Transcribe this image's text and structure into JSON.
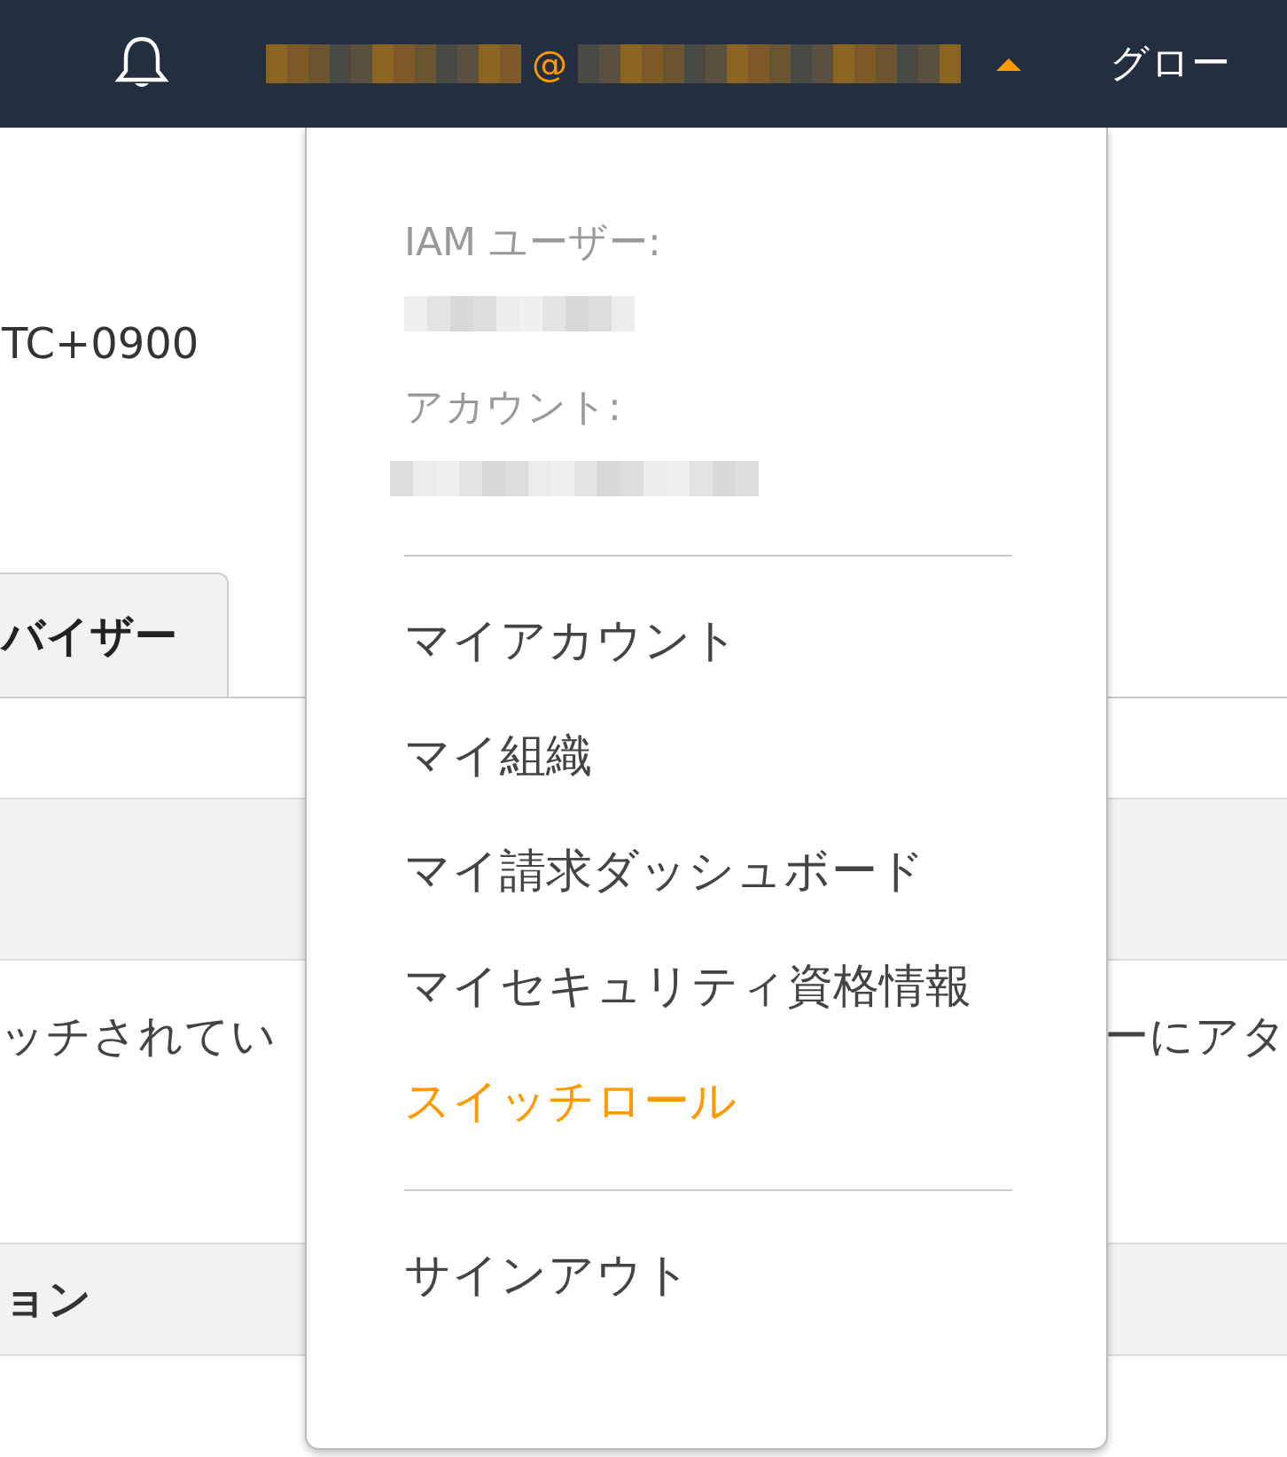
{
  "top_bar": {
    "at_sign": "@",
    "region_label": "グロー"
  },
  "page": {
    "timezone": "TC+0900",
    "tab": {
      "label": "バイザー",
      "selected": true
    },
    "text_left": "ッチされてい",
    "text_right": "ーにアタ",
    "section_header": "ョン"
  },
  "account_menu": {
    "iam_user_label": "IAM ユーザー:",
    "account_label": "アカウント:",
    "items": [
      {
        "label": "マイアカウント",
        "accent": false
      },
      {
        "label": "マイ組織",
        "accent": false
      },
      {
        "label": "マイ請求ダッシュボード",
        "accent": false
      },
      {
        "label": "マイセキュリティ資格情報",
        "accent": false
      },
      {
        "label": "スイッチロール",
        "accent": true
      }
    ],
    "sign_out": "サインアウト"
  }
}
